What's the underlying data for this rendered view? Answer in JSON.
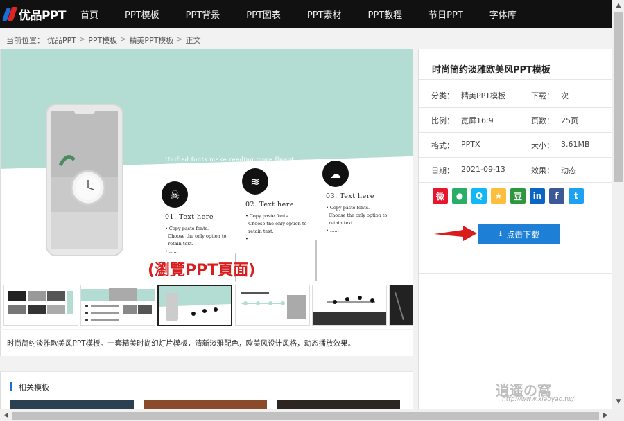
{
  "brand": {
    "logo_text": "优品PPT"
  },
  "nav": [
    "首页",
    "PPT模板",
    "PPT背景",
    "PPT图表",
    "PPT素材",
    "PPT教程",
    "节日PPT",
    "字体库"
  ],
  "breadcrumb": [
    "当前位置：",
    "优品PPT",
    ">",
    "PPT模板",
    ">",
    "精美PPT模板",
    ">",
    "正文"
  ],
  "slide": {
    "intro_lines": [
      "Unified fonts make reading more fluent.",
      "Theme color makes PPT more convenient to change.",
      "Adjust the spacing to adapt to Chinese typesetting, use the",
      "reference line in PPT."
    ],
    "steps": [
      {
        "title": "01. Text here",
        "items": [
          "Copy paste fonts.",
          "Choose the only option to",
          "retain text.",
          "……"
        ]
      },
      {
        "title": "02. Text here",
        "items": [
          "Copy paste fonts.",
          "Choose the only option to",
          "retain text.",
          "……"
        ]
      },
      {
        "title": "03. Text here",
        "items": [
          "Copy paste fonts.",
          "Choose the only option to",
          "retain text.",
          "……"
        ]
      }
    ],
    "accent": "#b3ddd3"
  },
  "caption": "(瀏覽PPT頁面)",
  "description": "时尚简约淡雅欧美风PPT模板。一套精美时尚幻灯片模板，清新淡雅配色，欧美风设计风格，动态播放效果。",
  "related_title": "相关模板",
  "sidebar": {
    "title": "时尚简约淡雅欧美风PPT模板",
    "rows": [
      {
        "l1": "分类：",
        "v1": "精美PPT模板",
        "l2": "下载：",
        "v2": "次"
      },
      {
        "l1": "比例：",
        "v1": "宽屏16:9",
        "l2": "页数：",
        "v2": "25页"
      },
      {
        "l1": "格式：",
        "v1": "PPTX",
        "l2": "大小：",
        "v2": "3.61MB"
      },
      {
        "l1": "日期：",
        "v1": "2021-09-13",
        "l2": "效果：",
        "v2": "动态"
      }
    ],
    "share": [
      {
        "name": "weibo-icon",
        "glyph": "微",
        "color": "#e6162d"
      },
      {
        "name": "wechat-icon",
        "glyph": "●",
        "color": "#2aae67"
      },
      {
        "name": "qq-icon",
        "glyph": "Q",
        "color": "#12b7f5"
      },
      {
        "name": "qzone-icon",
        "glyph": "★",
        "color": "#fdbe3d"
      },
      {
        "name": "douban-icon",
        "glyph": "豆",
        "color": "#2e963d"
      },
      {
        "name": "linkedin-icon",
        "glyph": "in",
        "color": "#0a66c2"
      },
      {
        "name": "facebook-icon",
        "glyph": "f",
        "color": "#3b5998"
      },
      {
        "name": "twitter-icon",
        "glyph": "t",
        "color": "#1da1f2"
      }
    ],
    "download_label": "点击下载"
  },
  "watermark": "逍遥の窩",
  "watermark_url": "http://www.xiaoyao.tw/"
}
